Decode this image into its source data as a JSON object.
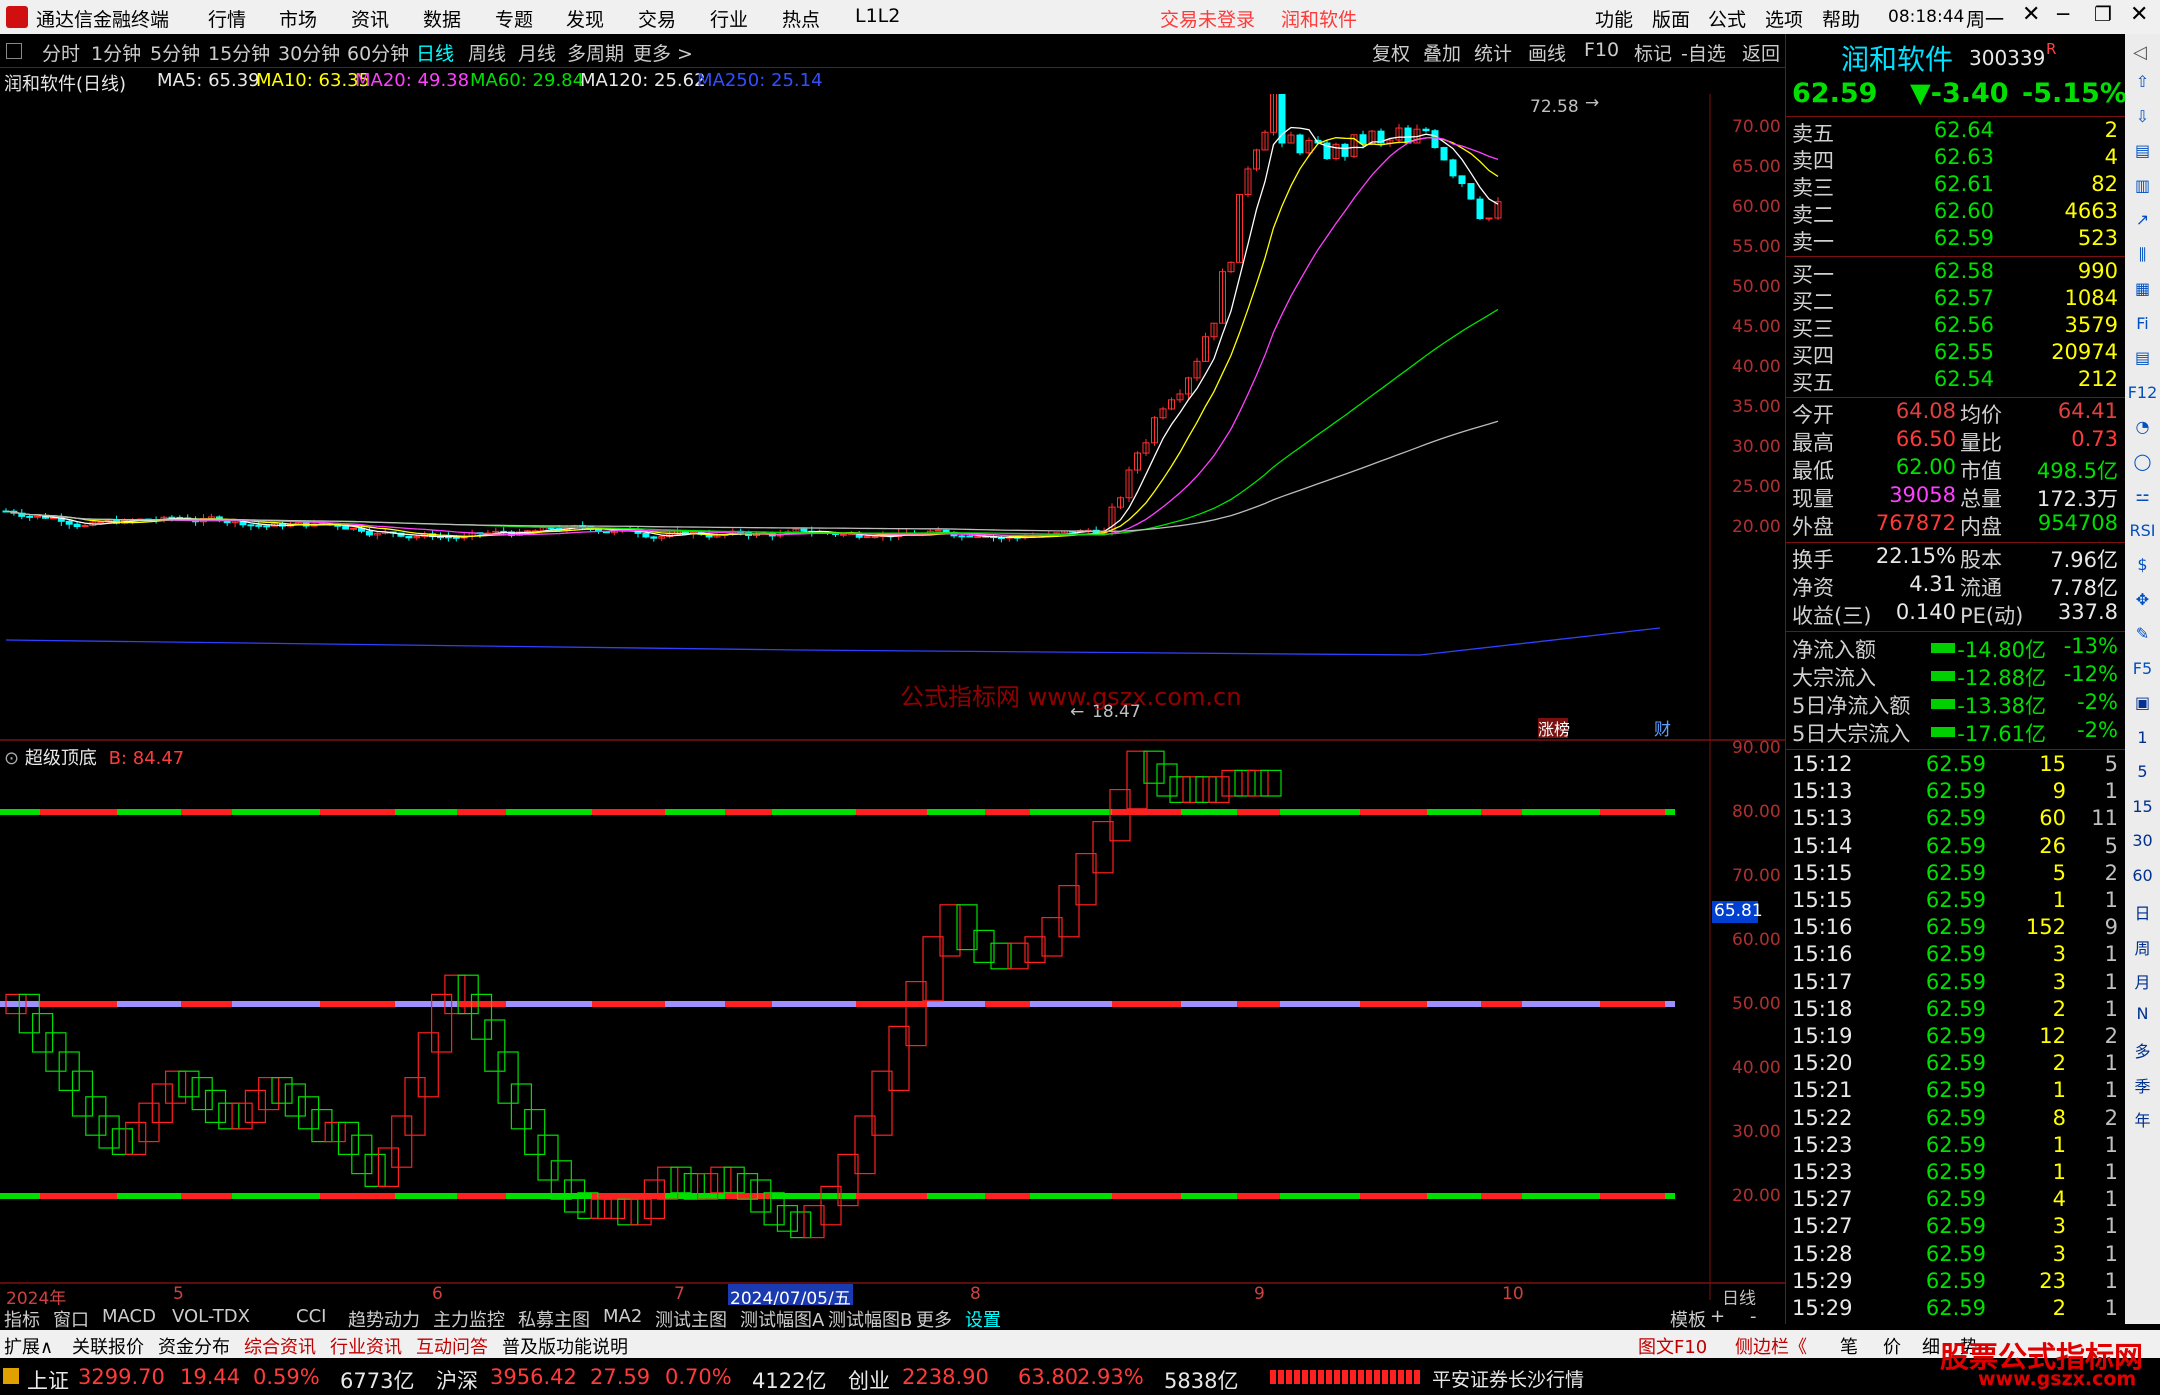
{
  "titlebar": {
    "app": "通达信金融终端",
    "menus": [
      "行情",
      "市场",
      "资讯",
      "数据",
      "专题",
      "发现",
      "交易",
      "行业",
      "热点",
      "L1L2"
    ],
    "notice1": "交易未登录",
    "notice2": "润和软件",
    "right_menus": [
      "功能",
      "版面",
      "公式",
      "选项",
      "帮助"
    ],
    "time": "08:18:44",
    "weekday": "周一"
  },
  "toolbar": {
    "periods": [
      "分时",
      "1分钟",
      "5分钟",
      "15分钟",
      "30分钟",
      "60分钟",
      "日线",
      "周线",
      "月线",
      "多周期",
      "更多 >"
    ],
    "active": "日线",
    "tools": [
      "复权",
      "叠加",
      "统计",
      "画线",
      "F10",
      "标记",
      "-自选",
      "返回"
    ]
  },
  "ma_line": {
    "name": "润和软件(日线)",
    "ma5": "MA5: 65.39",
    "ma10": "MA10: 63.35",
    "ma20": "MA20: 49.38",
    "ma60": "MA60: 29.84",
    "ma120": "MA120: 25.62",
    "ma250": "MA250: 25.14"
  },
  "main_chart": {
    "y_ticks": [
      "70.00",
      "65.00",
      "60.00",
      "55.00",
      "50.00",
      "45.00",
      "40.00",
      "35.00",
      "30.00",
      "25.00",
      "20.00"
    ],
    "high_label": "72.58",
    "low_label": "18.47",
    "marker1": "涨榜",
    "marker2": "财",
    "watermark": "公式指标网 www.gszx.com.cn"
  },
  "indicator": {
    "name": "超级顶底",
    "value": "B: 84.47",
    "y_ticks": [
      "90.00",
      "80.00",
      "70.00",
      "60.00",
      "50.00",
      "40.00",
      "30.00",
      "20.00"
    ],
    "current": "65.81"
  },
  "x_axis": {
    "labels": [
      "2024年",
      "5",
      "6",
      "7",
      "2024/07/05/五",
      "8",
      "9",
      "10"
    ],
    "period": "日线"
  },
  "quote": {
    "name": "润和软件",
    "code": "300339",
    "price": "62.59",
    "change": "▼-3.40",
    "pct": "-5.15%",
    "asks": [
      [
        "卖五",
        "62.64",
        "2"
      ],
      [
        "卖四",
        "62.63",
        "4"
      ],
      [
        "卖三",
        "62.61",
        "82"
      ],
      [
        "卖二",
        "62.60",
        "4663"
      ],
      [
        "卖一",
        "62.59",
        "523"
      ]
    ],
    "bids": [
      [
        "买一",
        "62.58",
        "990"
      ],
      [
        "买二",
        "62.57",
        "1084"
      ],
      [
        "买三",
        "62.56",
        "3579"
      ],
      [
        "买四",
        "62.55",
        "20974"
      ],
      [
        "买五",
        "62.54",
        "212"
      ]
    ],
    "stats": [
      [
        "今开",
        "64.08",
        "均价",
        "64.41"
      ],
      [
        "最高",
        "66.50",
        "量比",
        "0.73"
      ],
      [
        "最低",
        "62.00",
        "市值",
        "498.5亿"
      ],
      [
        "现量",
        "39058",
        "总量",
        "172.3万"
      ],
      [
        "外盘",
        "767872",
        "内盘",
        "954708"
      ]
    ],
    "stats2": [
      [
        "换手",
        "22.15%",
        "股本",
        "7.96亿"
      ],
      [
        "净资",
        "4.31",
        "流通",
        "7.78亿"
      ],
      [
        "收益(三)",
        "0.140",
        "PE(动)",
        "337.8"
      ]
    ],
    "flows": [
      [
        "净流入额",
        "-14.80亿",
        "-13%"
      ],
      [
        "大宗流入",
        "-12.88亿",
        "-12%"
      ],
      [
        "5日净流入额",
        "-13.38亿",
        "-2%"
      ],
      [
        "5日大宗流入",
        "-17.61亿",
        "-2%"
      ]
    ],
    "ticks": [
      [
        "15:12",
        "62.59",
        "15",
        "5"
      ],
      [
        "15:13",
        "62.59",
        "9",
        "1"
      ],
      [
        "15:13",
        "62.59",
        "60",
        "11"
      ],
      [
        "15:14",
        "62.59",
        "26",
        "5"
      ],
      [
        "15:15",
        "62.59",
        "5",
        "2"
      ],
      [
        "15:15",
        "62.59",
        "1",
        "1"
      ],
      [
        "15:16",
        "62.59",
        "152",
        "9"
      ],
      [
        "15:16",
        "62.59",
        "3",
        "1"
      ],
      [
        "15:17",
        "62.59",
        "3",
        "1"
      ],
      [
        "15:18",
        "62.59",
        "2",
        "1"
      ],
      [
        "15:19",
        "62.59",
        "12",
        "2"
      ],
      [
        "15:20",
        "62.59",
        "2",
        "1"
      ],
      [
        "15:21",
        "62.59",
        "1",
        "1"
      ],
      [
        "15:22",
        "62.59",
        "8",
        "2"
      ],
      [
        "15:23",
        "62.59",
        "1",
        "1"
      ],
      [
        "15:23",
        "62.59",
        "1",
        "1"
      ],
      [
        "15:27",
        "62.59",
        "4",
        "1"
      ],
      [
        "15:27",
        "62.59",
        "3",
        "1"
      ],
      [
        "15:28",
        "62.59",
        "3",
        "1"
      ],
      [
        "15:29",
        "62.59",
        "23",
        "1"
      ],
      [
        "15:29",
        "62.59",
        "2",
        "1"
      ]
    ]
  },
  "vtools": [
    "⇧",
    "⇩",
    "▤",
    "▥",
    "↗",
    "⫼",
    "▦",
    "Fi",
    "▤",
    "F12",
    "◔",
    "◯",
    "⚍",
    "RSI",
    "$",
    "✥",
    "✎",
    "F5",
    "▣",
    "1",
    "5",
    "15",
    "30",
    "60",
    "日",
    "周",
    "月",
    "N",
    "多",
    "季",
    "年"
  ],
  "tabs": {
    "items": [
      "指标",
      "窗口",
      "MACD",
      "VOL-TDX",
      "CCI",
      "趋势动力",
      "主力监控",
      "私募主图",
      "MA2",
      "测试主图",
      "测试幅图A",
      "测试幅图B",
      "更多",
      "设置"
    ],
    "right": [
      "模板",
      "+",
      "-"
    ]
  },
  "tabs2": {
    "items": [
      "扩展∧",
      "关联报价",
      "资金分布",
      "综合资讯",
      "行业资讯",
      "互动问答",
      "普及版功能说明"
    ],
    "right": [
      "图文F10",
      "侧边栏《",
      "笔",
      "价",
      "细",
      "势"
    ]
  },
  "status": {
    "sh_name": "上证",
    "sh_val": "3299.70",
    "sh_chg": "19.44",
    "sh_pct": "0.59%",
    "sh_amt": "6773亿",
    "sz_name": "沪深",
    "sz_val": "3956.42",
    "sz_chg": "27.59",
    "sz_pct": "0.70%",
    "sz_amt": "4122亿",
    "cy_name": "创业",
    "cy_val": "2238.90",
    "cy_chg": "63.80",
    "cy_pct": "2.93%",
    "cy_amt": "5838亿",
    "broker": "平安证券长沙行情",
    "logo": "股票公式指标网",
    "logo_url": "www.gszx.com"
  }
}
